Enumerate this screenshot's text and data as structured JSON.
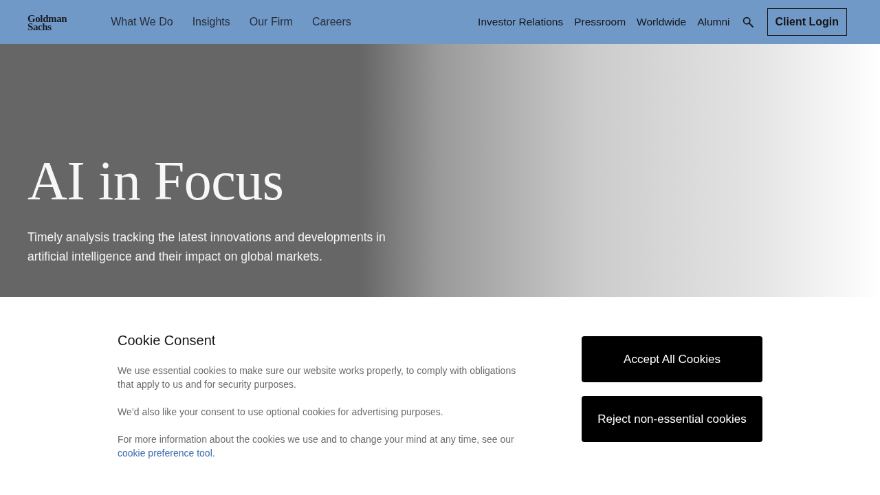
{
  "header": {
    "logo": [
      "Goldman",
      "Sachs"
    ],
    "primary_nav": [
      "What We Do",
      "Insights",
      "Our Firm",
      "Careers"
    ],
    "secondary_nav": [
      "Investor Relations",
      "Pressroom",
      "Worldwide",
      "Alumni"
    ],
    "client_login": "Client Login"
  },
  "hero": {
    "title": "AI in Focus",
    "subtitle": "Timely analysis tracking the latest innovations and developments in artificial intelligence and their impact on global markets."
  },
  "cookie_consent": {
    "title": "Cookie Consent",
    "paragraphs": [
      [
        {
          "kind": "text",
          "text": "We use essential cookies to make sure our website works properly, to comply with obligations that apply to us and for security purposes."
        }
      ],
      [
        {
          "kind": "text",
          "text": "We’d also like your consent to use optional cookies for advertising purposes."
        }
      ],
      [
        {
          "kind": "text",
          "text": "For more information about the cookies we use and to change your mind at any time, see our"
        },
        {
          "kind": "link",
          "text": "cookie preference tool"
        },
        {
          "kind": "text",
          "text": "."
        }
      ]
    ],
    "buttons": [
      "Accept All Cookies",
      "Reject non-essential cookies"
    ]
  }
}
